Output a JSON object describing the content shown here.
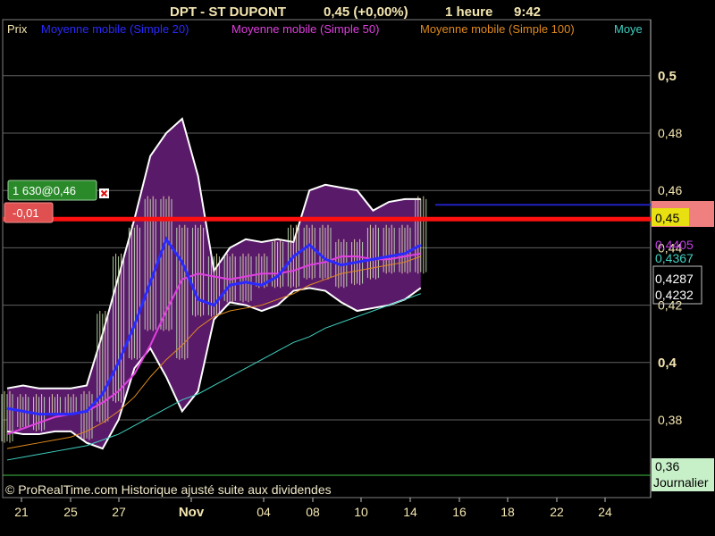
{
  "header": {
    "symbol": "DPT - ST DUPONT",
    "quote": "0,45 (+0,00%)",
    "interval": "1 heure",
    "time": "9:42"
  },
  "legend": [
    {
      "label": "Prix",
      "color": "#f4e6b0"
    },
    {
      "label": "Moyenne mobile (Simple 20)",
      "color": "#2a2aff"
    },
    {
      "label": "Moyenne mobile (Simple 50)",
      "color": "#e040e0"
    },
    {
      "label": "Moyenne mobile (Simple 100)",
      "color": "#e08a1e"
    },
    {
      "label": "Moye",
      "color": "#40d0c0"
    }
  ],
  "trade_tag": {
    "label": "1 630@0,46",
    "pnl": "-0,01"
  },
  "price_labels": [
    {
      "text": "0,45",
      "bg": "#e8e010",
      "fg": "#000000",
      "value": 0.45
    },
    {
      "text": "0,4405",
      "bg": "#000000",
      "fg": "#c040e0",
      "value": 0.4405
    },
    {
      "text": "0,4367",
      "bg": "#000000",
      "fg": "#40d0c0",
      "value": 0.4367
    },
    {
      "text": "0,4287",
      "bg": "#000000",
      "fg": "#ffffff",
      "value": 0.4287
    },
    {
      "text": "0,4232",
      "bg": "#000000",
      "fg": "#ffffff",
      "value": 0.4232
    }
  ],
  "bottom_label": {
    "value": "0,36",
    "period": "Journalier"
  },
  "credit": "© ProRealTime.com Historique ajusté suite aux dividendes",
  "colors": {
    "background": "#000000",
    "grid": "#606060",
    "band_fill": "#5a1a6a",
    "band_edge": "#ffffff",
    "sma20": "#2a2aff",
    "sma50": "#e040e0",
    "sma100": "#e08a1e",
    "sma200": "#40d0c0",
    "price_line": "#ff1010",
    "order_line": "#2020c0",
    "bar_up": "#c8f0c0",
    "bar_down": "#f4e6b0"
  },
  "chart_data": {
    "type": "line",
    "title": "DPT - ST DUPONT",
    "ylim": [
      0.36,
      0.52
    ],
    "yticks": [
      "0,38",
      "0,4",
      "0,42",
      "0,44",
      "0,46",
      "0,48",
      "0,5"
    ],
    "ytick_values": [
      0.38,
      0.4,
      0.42,
      0.44,
      0.46,
      0.48,
      0.5
    ],
    "yticks_major": [
      "0,4",
      "0,5"
    ],
    "xticks": [
      "21",
      "25",
      "27",
      "Nov",
      "04",
      "08",
      "10",
      "14",
      "16",
      "18",
      "22",
      "24"
    ],
    "xtick_bold": "Nov",
    "grid": true,
    "last_price": 0.45,
    "order_price": 0.455,
    "x": [
      0,
      1,
      2,
      3,
      4,
      5,
      6,
      7,
      8,
      9,
      10,
      11,
      12,
      13,
      14,
      15,
      16,
      17,
      18,
      19,
      20,
      21,
      22,
      23,
      24,
      25,
      26
    ],
    "band_upper": [
      0.391,
      0.392,
      0.391,
      0.391,
      0.391,
      0.392,
      0.41,
      0.43,
      0.45,
      0.472,
      0.48,
      0.485,
      0.465,
      0.432,
      0.44,
      0.443,
      0.442,
      0.443,
      0.442,
      0.46,
      0.462,
      0.461,
      0.46,
      0.453,
      0.456,
      0.457,
      0.457
    ],
    "band_lower": [
      0.376,
      0.375,
      0.375,
      0.376,
      0.376,
      0.372,
      0.37,
      0.38,
      0.398,
      0.405,
      0.395,
      0.383,
      0.39,
      0.415,
      0.421,
      0.42,
      0.418,
      0.42,
      0.425,
      0.426,
      0.425,
      0.421,
      0.418,
      0.419,
      0.42,
      0.422,
      0.426
    ],
    "series": [
      {
        "name": "Moyenne mobile (Simple 20)",
        "values": [
          0.384,
          0.383,
          0.382,
          0.382,
          0.382,
          0.383,
          0.389,
          0.4,
          0.413,
          0.428,
          0.443,
          0.435,
          0.422,
          0.42,
          0.427,
          0.428,
          0.427,
          0.43,
          0.437,
          0.441,
          0.436,
          0.434,
          0.435,
          0.436,
          0.437,
          0.438,
          0.441
        ]
      },
      {
        "name": "Moyenne mobile (Simple 50)",
        "values": [
          0.375,
          0.377,
          0.379,
          0.381,
          0.382,
          0.383,
          0.386,
          0.39,
          0.396,
          0.406,
          0.418,
          0.429,
          0.431,
          0.43,
          0.429,
          0.43,
          0.431,
          0.431,
          0.432,
          0.434,
          0.435,
          0.437,
          0.437,
          0.436,
          0.436,
          0.437,
          0.438
        ]
      },
      {
        "name": "Moyenne mobile (Simple 100)",
        "values": [
          0.37,
          0.371,
          0.372,
          0.373,
          0.374,
          0.376,
          0.379,
          0.383,
          0.388,
          0.395,
          0.401,
          0.406,
          0.412,
          0.416,
          0.418,
          0.419,
          0.42,
          0.422,
          0.424,
          0.427,
          0.429,
          0.431,
          0.432,
          0.433,
          0.434,
          0.435,
          0.437
        ]
      },
      {
        "name": "Moye",
        "values": [
          0.366,
          0.367,
          0.368,
          0.369,
          0.37,
          0.371,
          0.373,
          0.375,
          0.378,
          0.381,
          0.384,
          0.387,
          0.389,
          0.392,
          0.395,
          0.398,
          0.401,
          0.404,
          0.407,
          0.409,
          0.412,
          0.414,
          0.416,
          0.418,
          0.42,
          0.422,
          0.424
        ]
      }
    ],
    "bars": [
      {
        "high": 0.392,
        "low": 0.371
      },
      {
        "high": 0.391,
        "low": 0.376
      },
      {
        "high": 0.391,
        "low": 0.375
      },
      {
        "high": 0.391,
        "low": 0.381
      },
      {
        "high": 0.391,
        "low": 0.381
      },
      {
        "high": 0.392,
        "low": 0.372
      },
      {
        "high": 0.42,
        "low": 0.378
      },
      {
        "high": 0.44,
        "low": 0.385
      },
      {
        "high": 0.45,
        "low": 0.4
      },
      {
        "high": 0.46,
        "low": 0.41
      },
      {
        "high": 0.46,
        "low": 0.41
      },
      {
        "high": 0.45,
        "low": 0.4
      },
      {
        "high": 0.45,
        "low": 0.415
      },
      {
        "high": 0.44,
        "low": 0.415
      },
      {
        "high": 0.44,
        "low": 0.42
      },
      {
        "high": 0.44,
        "low": 0.42
      },
      {
        "high": 0.44,
        "low": 0.425
      },
      {
        "high": 0.445,
        "low": 0.425
      },
      {
        "high": 0.45,
        "low": 0.425
      },
      {
        "high": 0.45,
        "low": 0.428
      },
      {
        "high": 0.45,
        "low": 0.428
      },
      {
        "high": 0.445,
        "low": 0.425
      },
      {
        "high": 0.445,
        "low": 0.426
      },
      {
        "high": 0.45,
        "low": 0.428
      },
      {
        "high": 0.45,
        "low": 0.43
      },
      {
        "high": 0.45,
        "low": 0.43
      },
      {
        "high": 0.46,
        "low": 0.43
      }
    ]
  }
}
